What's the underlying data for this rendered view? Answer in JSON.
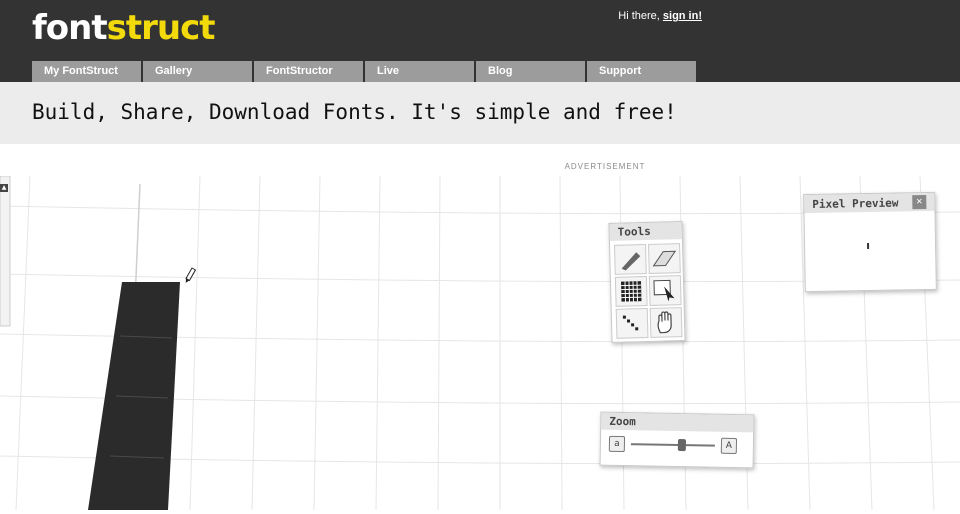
{
  "header": {
    "logo_part1": "font",
    "logo_part2": "struct",
    "greeting_text": "Hi there, ",
    "signin_label": "sign in!"
  },
  "nav": {
    "tabs": [
      {
        "label": "My FontStruct"
      },
      {
        "label": "Gallery"
      },
      {
        "label": "FontStructor"
      },
      {
        "label": "Live"
      },
      {
        "label": "Blog"
      },
      {
        "label": "Support"
      }
    ]
  },
  "tagline": "Build, Share, Download Fonts. It's simple and free!",
  "ad_label": "ADVERTISEMENT",
  "tools": {
    "title": "Tools",
    "items": [
      "pencil-tool-icon",
      "eraser-tool-icon",
      "grid-tool-icon",
      "select-tool-icon",
      "line-tool-icon",
      "hand-tool-icon"
    ]
  },
  "pixel_preview": {
    "title": "Pixel Preview",
    "close_label": "✕"
  },
  "zoom": {
    "title": "Zoom",
    "level": 0.62
  },
  "colors": {
    "header_bg": "#333333",
    "logo_yellow": "#f3da0b",
    "nav_tab_bg": "#9c9c9c",
    "tagline_bg": "#ececec"
  }
}
